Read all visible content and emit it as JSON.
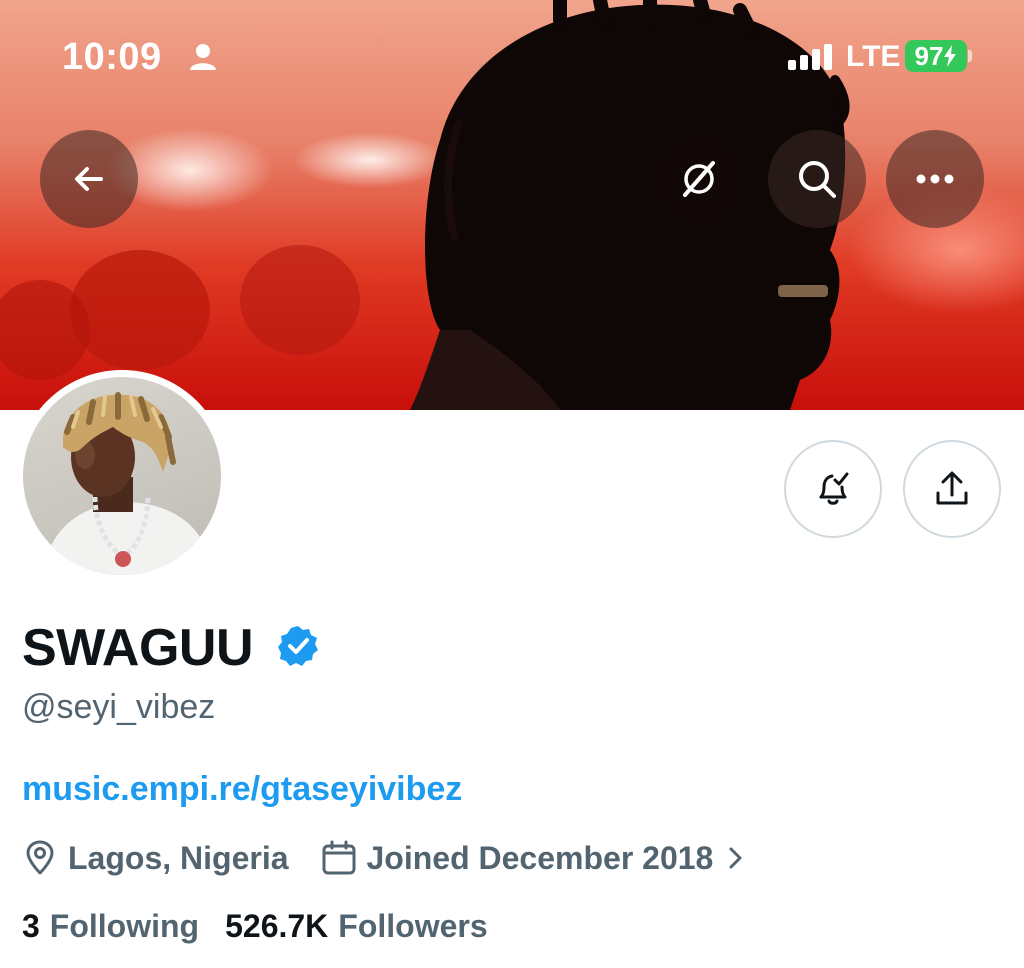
{
  "status_bar": {
    "time": "10:09",
    "network": "LTE",
    "battery": "97"
  },
  "banner_buttons": {
    "back_icon": "arrow-left-icon",
    "grok_icon": "grok-slash-circle-icon",
    "search_icon": "search-icon",
    "more_icon": "more-horizontal-icon"
  },
  "profile": {
    "display_name": "SWAGUU",
    "verified": true,
    "handle": "@seyi_vibez",
    "website": "music.empi.re/gtaseyivibez",
    "location": "Lagos, Nigeria",
    "joined": "Joined December 2018",
    "following_count": "3",
    "following_label": "Following",
    "followers_count": "526.7K",
    "followers_label": "Followers"
  },
  "actions": {
    "notify_icon": "bell-check-icon",
    "share_icon": "share-upload-icon"
  },
  "colors": {
    "accent": "#1d9bf0",
    "secondary_text": "#536471",
    "primary_text": "#0f1419",
    "border": "#cfd9de",
    "battery": "#34c759"
  }
}
